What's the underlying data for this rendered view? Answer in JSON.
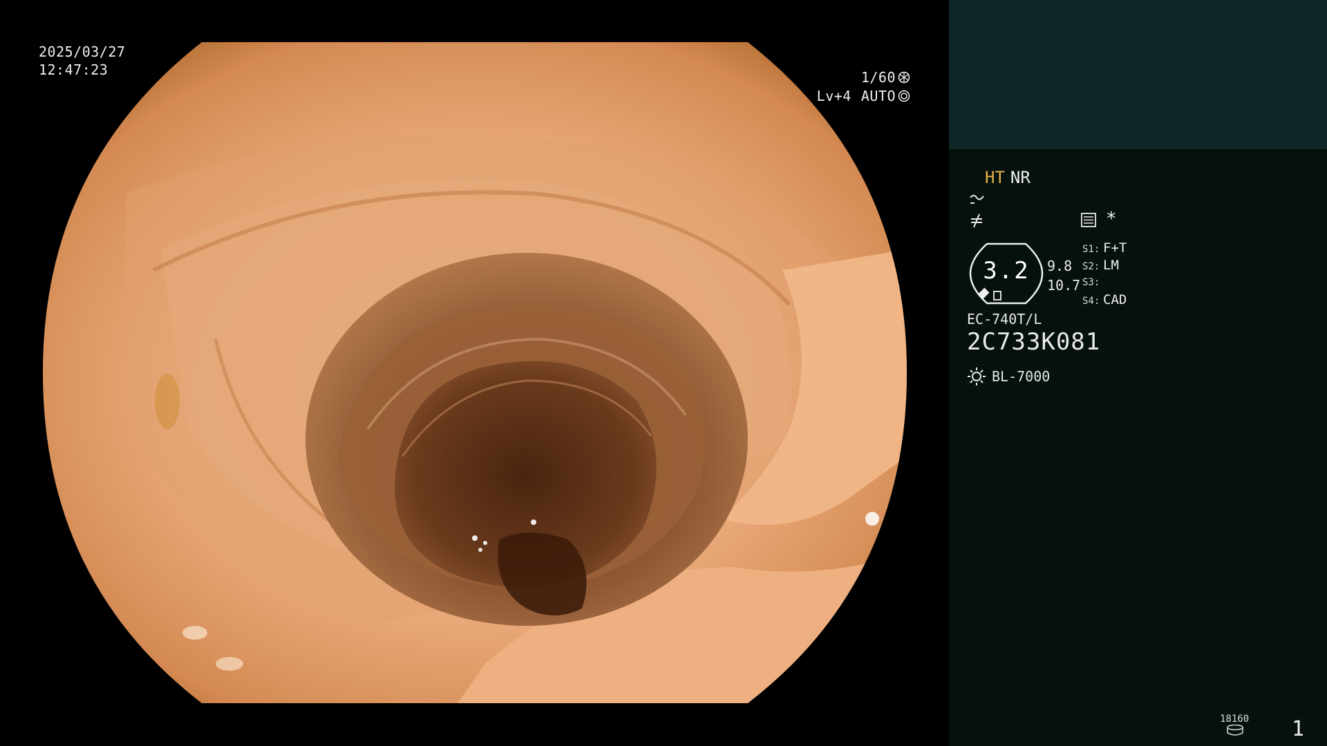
{
  "overlay": {
    "date": "2025/03/27",
    "time": "12:47:23",
    "shutter": "1/60",
    "level": "Lv+4",
    "iris": "AUTO"
  },
  "panel": {
    "mode_ht": "HT",
    "mode_nr": "NR",
    "asterisk": "*",
    "zoom": {
      "value": "3.2",
      "sub1": "9.8",
      "sub2": "10.7"
    },
    "switches": [
      {
        "key": "S1:",
        "value": "F+T"
      },
      {
        "key": "S2:",
        "value": "LM"
      },
      {
        "key": "S3:",
        "value": ""
      },
      {
        "key": "S4:",
        "value": "CAD"
      }
    ],
    "scope_model": "EC-740T/L",
    "scope_serial": "2C733K081",
    "light_source": "BL-7000",
    "counter": "18160",
    "page": "1"
  },
  "colors": {
    "panel_bg": "#06110f",
    "panel_top": "#0f2726",
    "ht_accent": "#e6b24a",
    "mucosa": "#e8a878"
  },
  "icons": [
    "shutter-icon",
    "iris-icon",
    "structure-enhance-icon",
    "color-enhance-icon",
    "settings-list-icon",
    "zoom-frame-icon",
    "light-source-icon",
    "storage-icon"
  ]
}
